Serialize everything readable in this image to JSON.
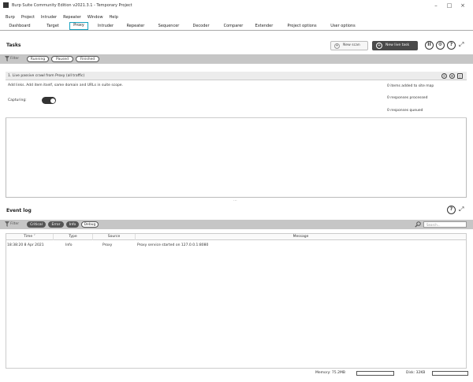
{
  "window": {
    "title": "Burp Suite Community Edition v2021.3.1 - Temporary Project",
    "minimize": "–",
    "maximize": "□",
    "close": "×"
  },
  "menu": [
    "Burp",
    "Project",
    "Intruder",
    "Repeater",
    "Window",
    "Help"
  ],
  "tabs": [
    "Dashboard",
    "Target",
    "Proxy",
    "Intruder",
    "Repeater",
    "Sequencer",
    "Decoder",
    "Comparer",
    "Extender",
    "Project options",
    "User options"
  ],
  "active_tab": "Proxy",
  "tasks": {
    "title": "Tasks",
    "new_scan_label": "New scan",
    "new_live_task_label": "New live task",
    "filter_label": "Filter",
    "filters": [
      "Running",
      "Paused",
      "Finished"
    ],
    "task": {
      "name": "1. Live passive crawl from Proxy (all traffic)",
      "description": "Add links. Add item itself, same domain and URLs in suite scope.",
      "capturing_label": "Capturing:",
      "capturing_on": true,
      "stats": [
        "0 items added to site map",
        "0 responses processed",
        "0 responses queued"
      ]
    }
  },
  "event_log": {
    "title": "Event log",
    "filter_label": "Filter",
    "filters": [
      "Critical",
      "Error",
      "Info",
      "Debug"
    ],
    "search_placeholder": "Search...",
    "columns": [
      "Time",
      "Type",
      "Source",
      "Message"
    ],
    "rows": [
      {
        "time": "18:38:20 8 Apr 2021",
        "type": "Info",
        "source": "Proxy",
        "message": "Proxy service started on 127.0.0.1:8080"
      }
    ]
  },
  "status": {
    "memory_label": "Memory: 75.2MB",
    "disk_label": "Disk: 32KB"
  },
  "colors": {
    "active_tab_border": "#17a2c0",
    "filter_bar": "#c6c6c6",
    "dark_button": "#4a4a4a"
  }
}
